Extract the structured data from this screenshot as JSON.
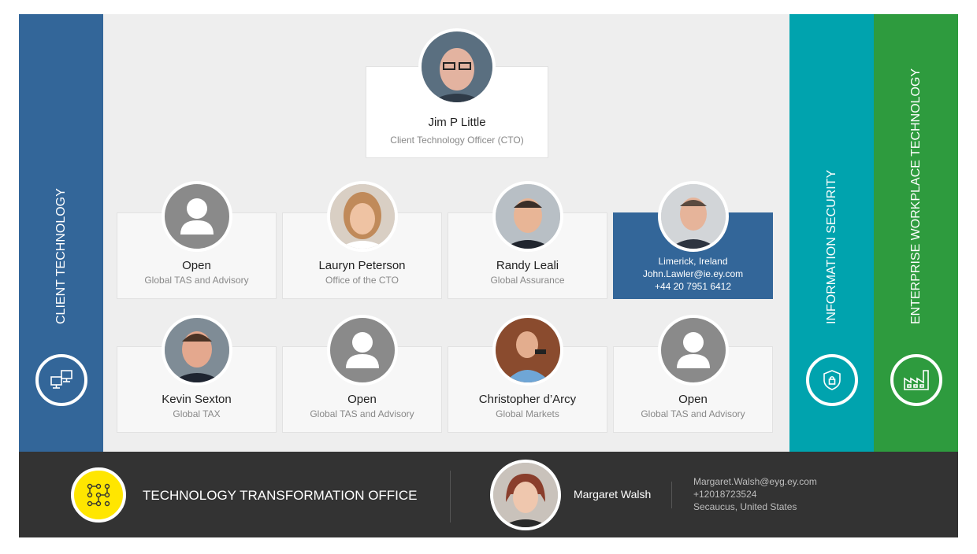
{
  "columns": {
    "client": {
      "title": "CLIENT TECHNOLOGY",
      "icon": "network-computers-icon",
      "color": "#336699"
    },
    "security": {
      "title": "INFORMATION SECURITY",
      "icon": "shield-lock-icon",
      "color": "#00a3ae"
    },
    "workplace": {
      "title": "ENTERPRISE WORKPLACE TECHNOLOGY",
      "icon": "factory-icon",
      "color": "#2e9b3e"
    }
  },
  "leader": {
    "name": "Jim P Little",
    "role": "Client Technology Officer (CTO)"
  },
  "row1": [
    {
      "name": "Open",
      "role": "Global TAS and Advisory"
    },
    {
      "name": "Lauryn Peterson",
      "role": "Office of the CTO"
    },
    {
      "name": "Randy Leali",
      "role": "Global Assurance"
    },
    {
      "location": "Limerick, Ireland",
      "email": "John.Lawler@ie.ey.com",
      "phone": "+44 20 7951 6412"
    }
  ],
  "row2": [
    {
      "name": "Kevin Sexton",
      "role": "Global TAX"
    },
    {
      "name": "Open",
      "role": "Global TAS and Advisory"
    },
    {
      "name": "Christopher d’Arcy",
      "role": "Global Markets"
    },
    {
      "name": "Open",
      "role": "Global TAS and Advisory"
    }
  ],
  "bottom": {
    "title": "TECHNOLOGY TRANSFORMATION OFFICE",
    "icon": "network-dots-icon",
    "accent": "#ffe600",
    "contact": {
      "name": "Margaret Walsh",
      "email": "Margaret.Walsh@eyg.ey.com",
      "phone": "+12018723524",
      "location": "Secaucus, United States"
    }
  }
}
